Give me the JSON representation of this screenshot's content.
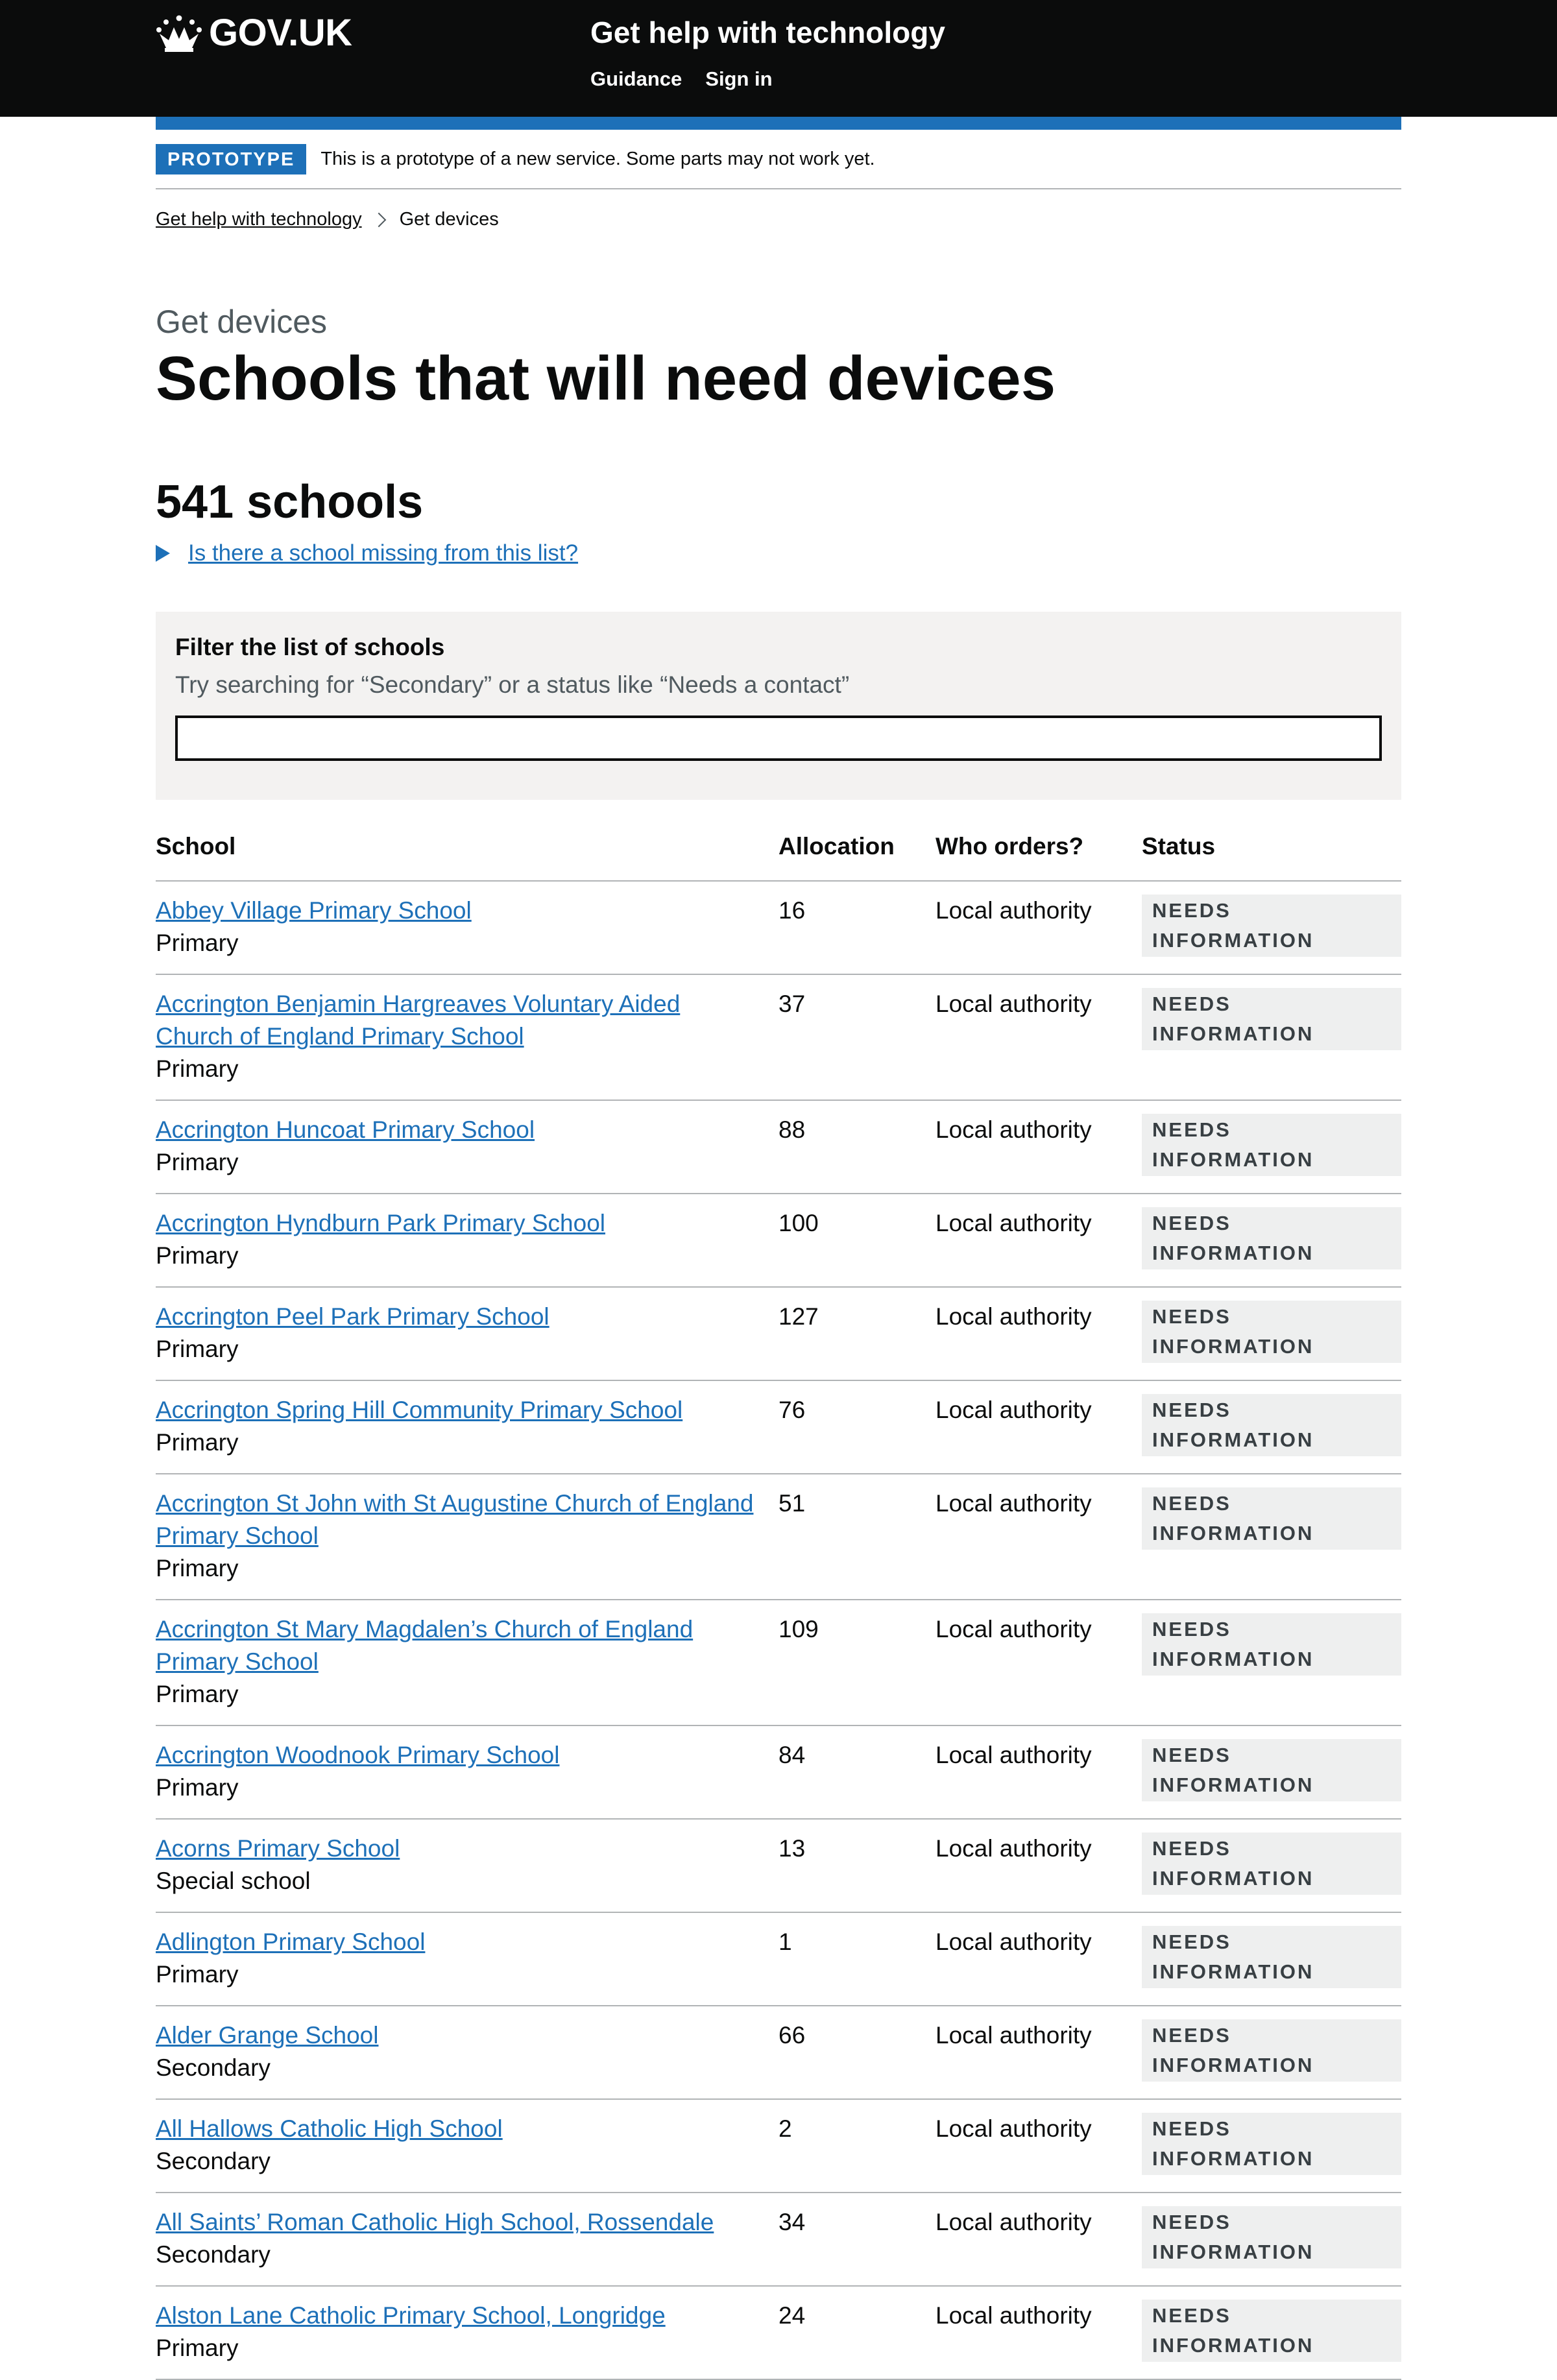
{
  "header": {
    "logo_text": "GOV.UK",
    "service_name": "Get help with technology",
    "nav": [
      "Guidance",
      "Sign in"
    ]
  },
  "phase": {
    "tag": "PROTOTYPE",
    "text": "This is a prototype of a new service. Some parts may not work yet."
  },
  "breadcrumbs": [
    "Get help with technology",
    "Get devices"
  ],
  "caption": "Get devices",
  "title": "Schools that will need devices",
  "count_heading": "541 schools",
  "details_summary": "Is there a school missing from this list?",
  "filter": {
    "label": "Filter the list of schools",
    "hint": "Try searching for “Secondary” or a status like “Needs a contact”",
    "value": ""
  },
  "table": {
    "headers": [
      "School",
      "Allocation",
      "Who orders?",
      "Status"
    ],
    "rows": [
      {
        "name": "Abbey Village Primary School",
        "type": "Primary",
        "allocation": "16",
        "who": "Local authority",
        "status": "NEEDS INFORMATION"
      },
      {
        "name": "Accrington Benjamin Hargreaves Voluntary Aided Church of England Primary School",
        "type": "Primary",
        "allocation": "37",
        "who": "Local authority",
        "status": "NEEDS INFORMATION"
      },
      {
        "name": "Accrington Huncoat Primary School",
        "type": "Primary",
        "allocation": "88",
        "who": "Local authority",
        "status": "NEEDS INFORMATION"
      },
      {
        "name": "Accrington Hyndburn Park Primary School",
        "type": "Primary",
        "allocation": "100",
        "who": "Local authority",
        "status": "NEEDS INFORMATION"
      },
      {
        "name": "Accrington Peel Park Primary School",
        "type": "Primary",
        "allocation": "127",
        "who": "Local authority",
        "status": "NEEDS INFORMATION"
      },
      {
        "name": "Accrington Spring Hill Community Primary School",
        "type": "Primary",
        "allocation": "76",
        "who": "Local authority",
        "status": "NEEDS INFORMATION"
      },
      {
        "name": "Accrington St John with St Augustine Church of England Primary School",
        "type": "Primary",
        "allocation": "51",
        "who": "Local authority",
        "status": "NEEDS INFORMATION"
      },
      {
        "name": "Accrington St Mary Magdalen’s Church of England Primary School",
        "type": "Primary",
        "allocation": "109",
        "who": "Local authority",
        "status": "NEEDS INFORMATION"
      },
      {
        "name": "Accrington Woodnook Primary School",
        "type": "Primary",
        "allocation": "84",
        "who": "Local authority",
        "status": "NEEDS INFORMATION"
      },
      {
        "name": "Acorns Primary School",
        "type": "Special school",
        "allocation": "13",
        "who": "Local authority",
        "status": "NEEDS INFORMATION"
      },
      {
        "name": "Adlington Primary School",
        "type": "Primary",
        "allocation": "1",
        "who": "Local authority",
        "status": "NEEDS INFORMATION"
      },
      {
        "name": "Alder Grange School",
        "type": "Secondary",
        "allocation": "66",
        "who": "Local authority",
        "status": "NEEDS INFORMATION"
      },
      {
        "name": "All Hallows Catholic High School",
        "type": "Secondary",
        "allocation": "2",
        "who": "Local authority",
        "status": "NEEDS INFORMATION"
      },
      {
        "name": "All Saints’ Roman Catholic High School, Rossendale",
        "type": "Secondary",
        "allocation": "34",
        "who": "Local authority",
        "status": "NEEDS INFORMATION"
      },
      {
        "name": "Alston Lane Catholic Primary School, Longridge",
        "type": "Primary",
        "allocation": "24",
        "who": "Local authority",
        "status": "NEEDS INFORMATION"
      }
    ]
  }
}
